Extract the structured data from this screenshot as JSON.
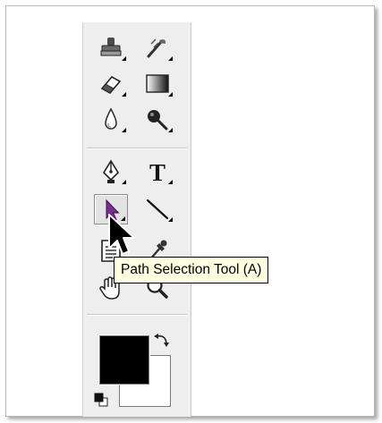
{
  "tooltip": {
    "text": "Path Selection Tool (A)"
  },
  "tools": [
    {
      "name": "clone-stamp-tool",
      "icon": "stamp-icon"
    },
    {
      "name": "history-brush-tool",
      "icon": "history-brush-icon"
    },
    {
      "name": "eraser-tool",
      "icon": "eraser-icon"
    },
    {
      "name": "gradient-tool",
      "icon": "gradient-icon"
    },
    {
      "name": "blur-tool",
      "icon": "water-drop-icon"
    },
    {
      "name": "dodge-tool",
      "icon": "dodge-icon"
    },
    {
      "name": "pen-tool",
      "icon": "pen-nib-icon"
    },
    {
      "name": "type-tool",
      "icon": "type-icon",
      "glyph": "T"
    },
    {
      "name": "path-selection-tool",
      "icon": "arrow-pointer-icon",
      "active": true
    },
    {
      "name": "line-tool",
      "icon": "line-icon"
    },
    {
      "name": "notes-tool",
      "icon": "note-icon"
    },
    {
      "name": "eyedropper-tool",
      "icon": "eyedropper-icon"
    },
    {
      "name": "hand-tool",
      "icon": "hand-icon"
    },
    {
      "name": "zoom-tool",
      "icon": "magnifier-icon"
    }
  ],
  "colors": {
    "foreground": "#000000",
    "background": "#ffffff",
    "path_selection_accent": "#7b2d8e",
    "tooltip_bg": "#ffffe1"
  }
}
